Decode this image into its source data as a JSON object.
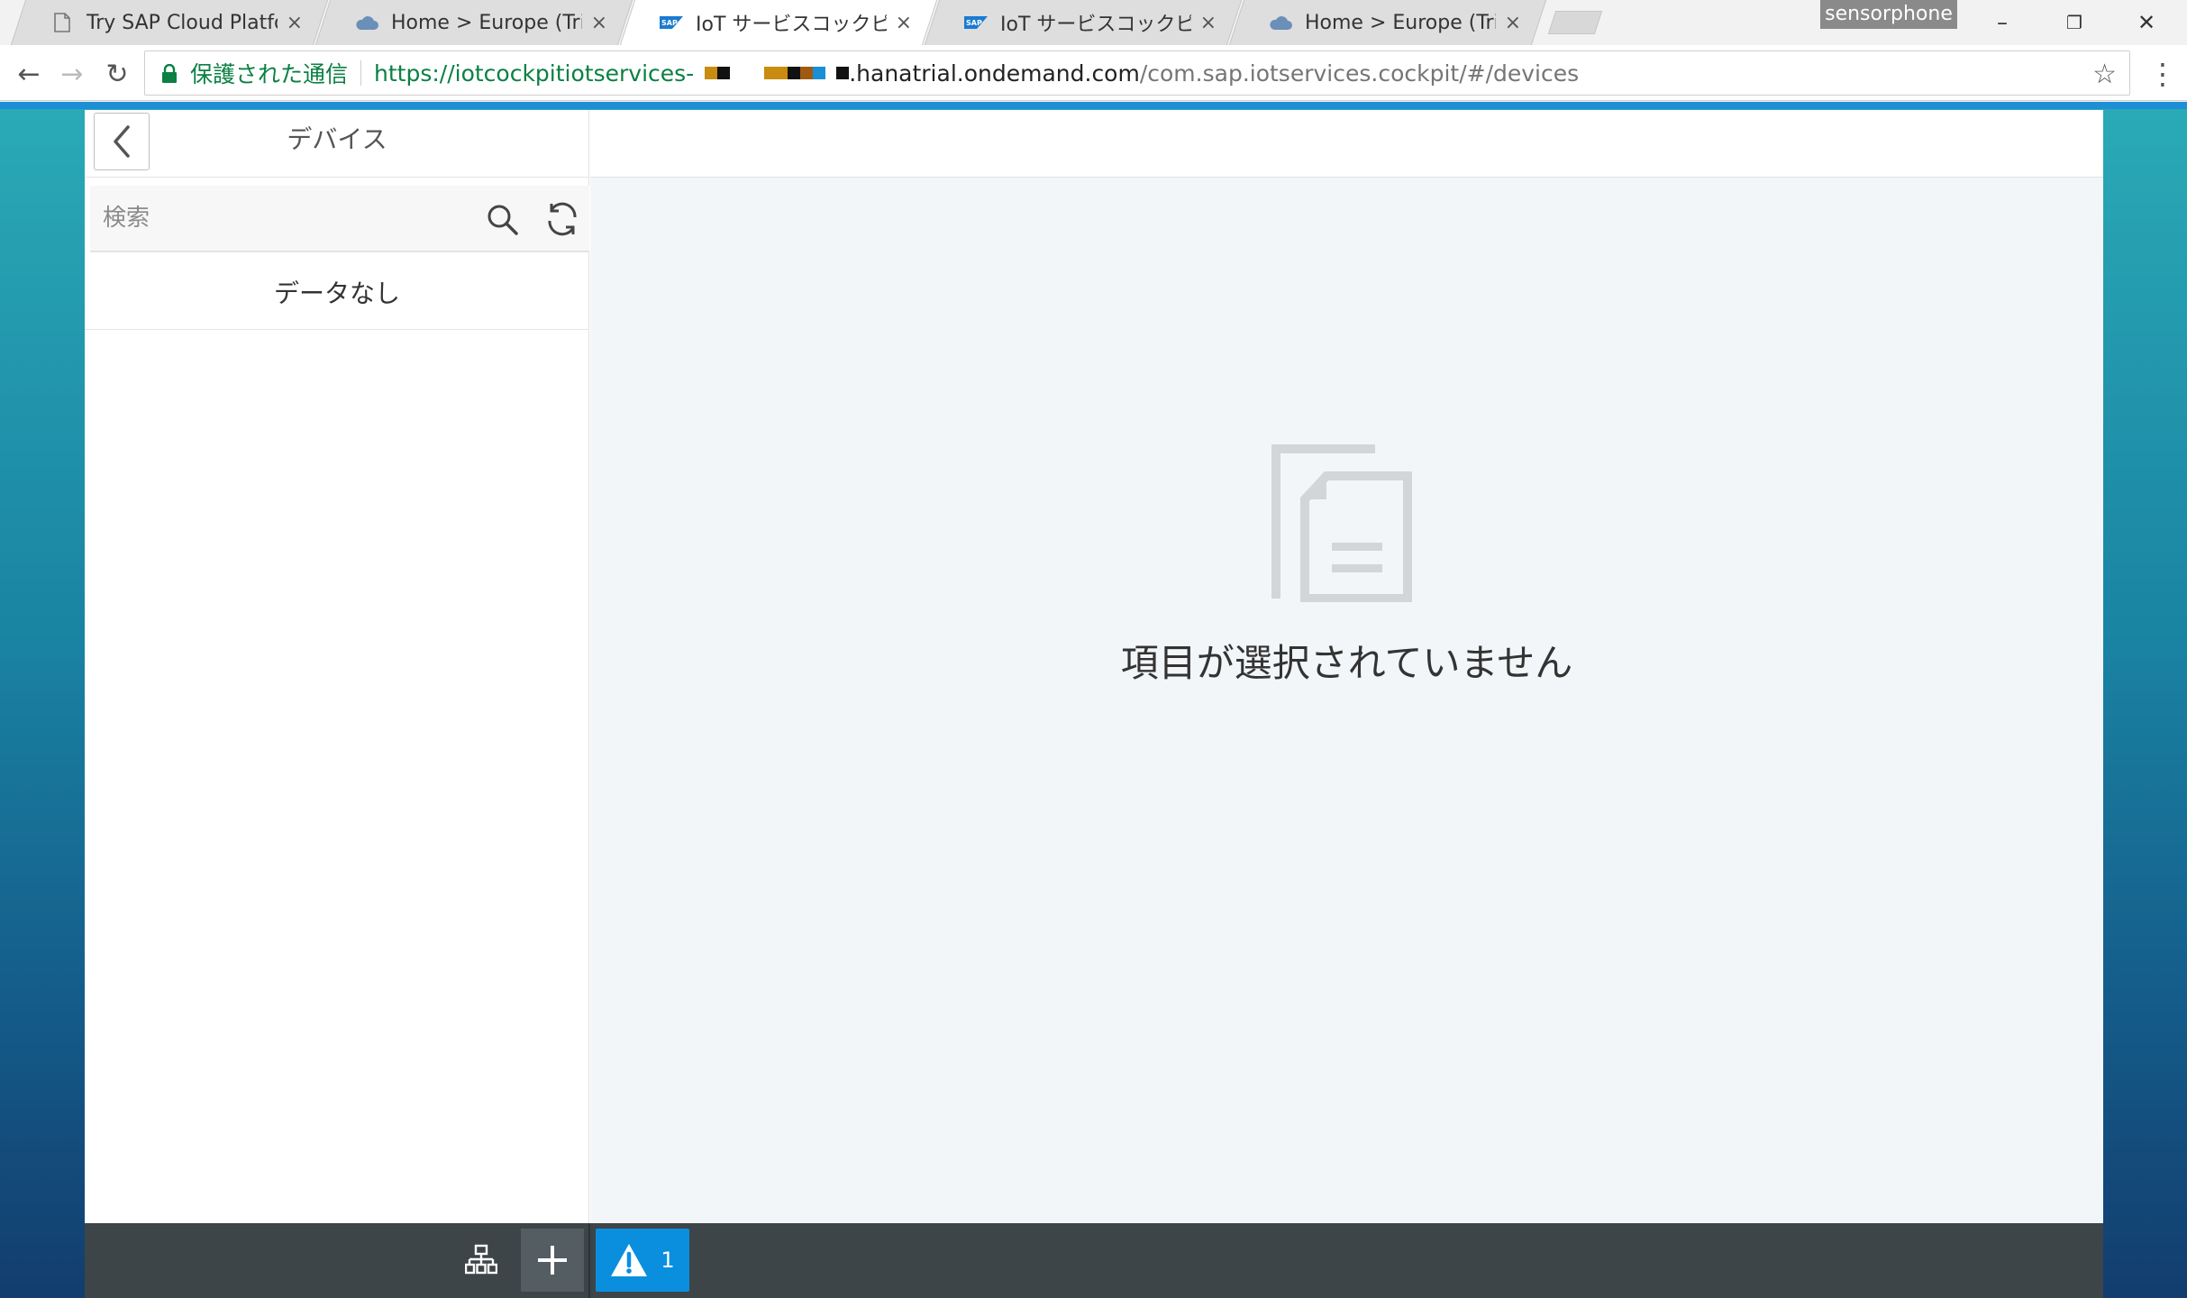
{
  "browser": {
    "tabs": [
      {
        "title": "Try SAP Cloud Platform",
        "favicon": "page-icon",
        "active": false
      },
      {
        "title": "Home > Europe (Trial) >",
        "favicon": "cloud-icon",
        "active": false
      },
      {
        "title": "IoT サービスコックピット",
        "favicon": "sap-logo-icon",
        "active": true
      },
      {
        "title": "IoT サービスコックピット",
        "favicon": "sap-logo-icon",
        "active": false
      },
      {
        "title": "Home > Europe (Trial) >",
        "favicon": "cloud-icon",
        "active": false
      }
    ],
    "tab_close": "×",
    "profile_name": "sensorphone",
    "window_controls": {
      "minimize": "–",
      "restore": "❐",
      "close": "✕"
    },
    "nav": {
      "back": "←",
      "forward": "→",
      "reload": "↻"
    },
    "address": {
      "security_label": "保護された通信",
      "scheme_and_host_start": "https://iotcockpitiotservices-",
      "host_end": ".hanatrial.ondemand.com",
      "path": "/com.sap.iotservices.cockpit/#/devices"
    },
    "bookmark_icon": "☆",
    "menu_icon": "⋮"
  },
  "app": {
    "master": {
      "title": "デバイス",
      "search_placeholder": "検索",
      "no_data_text": "データなし"
    },
    "detail": {
      "empty_message": "項目が選択されていません"
    },
    "footer": {
      "warning_count": "1"
    }
  },
  "colors": {
    "accent": "#0a8fdf",
    "footer_bg": "#3d4549",
    "secure_green": "#0b8043"
  }
}
